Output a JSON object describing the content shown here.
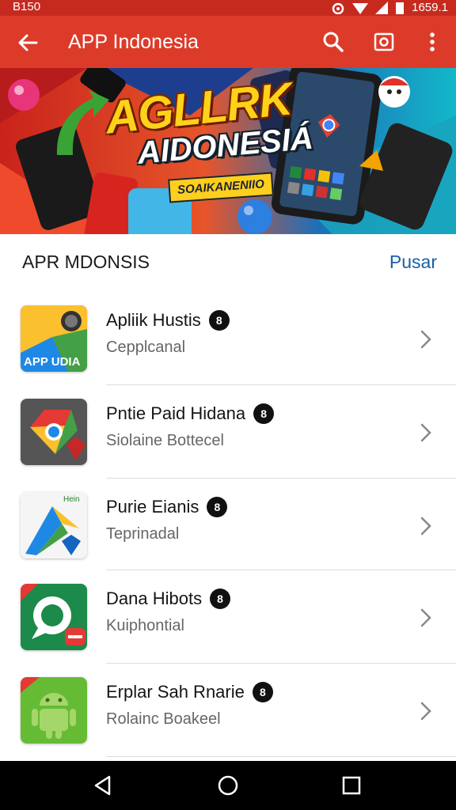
{
  "status_bar": {
    "left_text": "B150",
    "time": "1659.1"
  },
  "app_bar": {
    "title": "APP Indonesia"
  },
  "banner": {
    "title": "AGLLRK",
    "subtitle": "AIDONESIÁ",
    "tag": "SOAIKANENIIO"
  },
  "section": {
    "title": "APR MDONSIS",
    "action": "Pusar"
  },
  "apps": [
    {
      "name": "Apliik Hustis",
      "subtitle": "Cepplcanal",
      "icon_text": "APP UDIA",
      "badge": "8"
    },
    {
      "name": "Pntie Paid Hidana",
      "subtitle": "Siolaine Bottecel",
      "icon_text": "",
      "badge": "8"
    },
    {
      "name": "Purie Eianis",
      "subtitle": "Teprinadal",
      "icon_text": "Hein",
      "badge": "8"
    },
    {
      "name": "Dana Hibots",
      "subtitle": "Kuiphontial",
      "icon_text": "",
      "badge": "8"
    },
    {
      "name": "Erplar Sah Rnarie",
      "subtitle": "Rolainc Boakeel",
      "icon_text": "",
      "badge": "8"
    }
  ],
  "colors": {
    "status_bar": "#c62a1f",
    "app_bar": "#dd3b2a",
    "accent_link": "#1a5fa8"
  }
}
